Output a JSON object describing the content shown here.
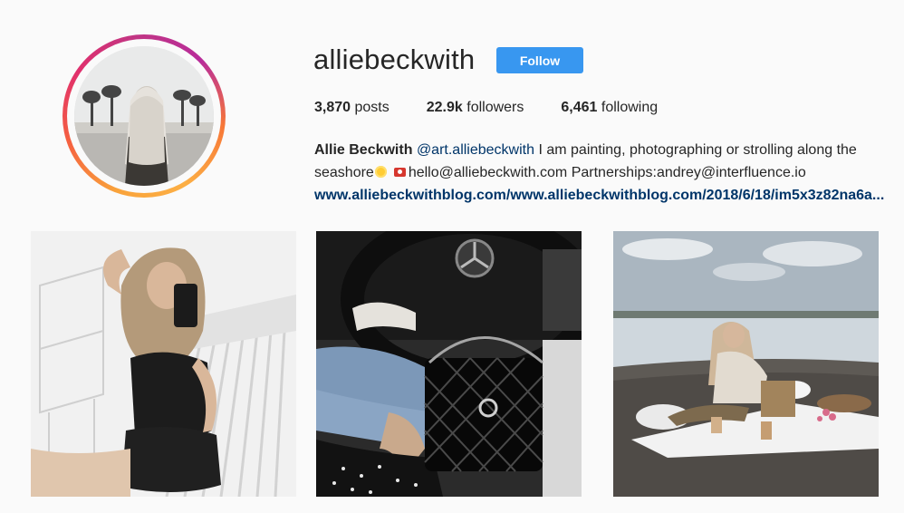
{
  "profile": {
    "username": "alliebeckwith",
    "follow_label": "Follow",
    "stats": {
      "posts_count": "3,870",
      "posts_label": "posts",
      "followers_count": "22.9k",
      "followers_label": "followers",
      "following_count": "6,461",
      "following_label": "following"
    },
    "bio": {
      "name": "Allie Beckwith",
      "mention": "@art.alliebeckwith",
      "text1": " I am painting, photographing or strolling along the seashore",
      "text2": "hello@alliebeckwith.com Partnerships:andrey@interfluence.io",
      "link": "www.alliebeckwithblog.com/www.alliebeckwithblog.com/2018/6/18/im5x3z82na6a..."
    }
  },
  "posts": [
    {
      "alt": "mirror selfie in black romper"
    },
    {
      "alt": "car interior with quilted black handbag"
    },
    {
      "alt": "beach picnic with woman reading"
    }
  ],
  "colors": {
    "follow_button": "#3897f0",
    "link": "#003569",
    "background": "#fafafa"
  }
}
